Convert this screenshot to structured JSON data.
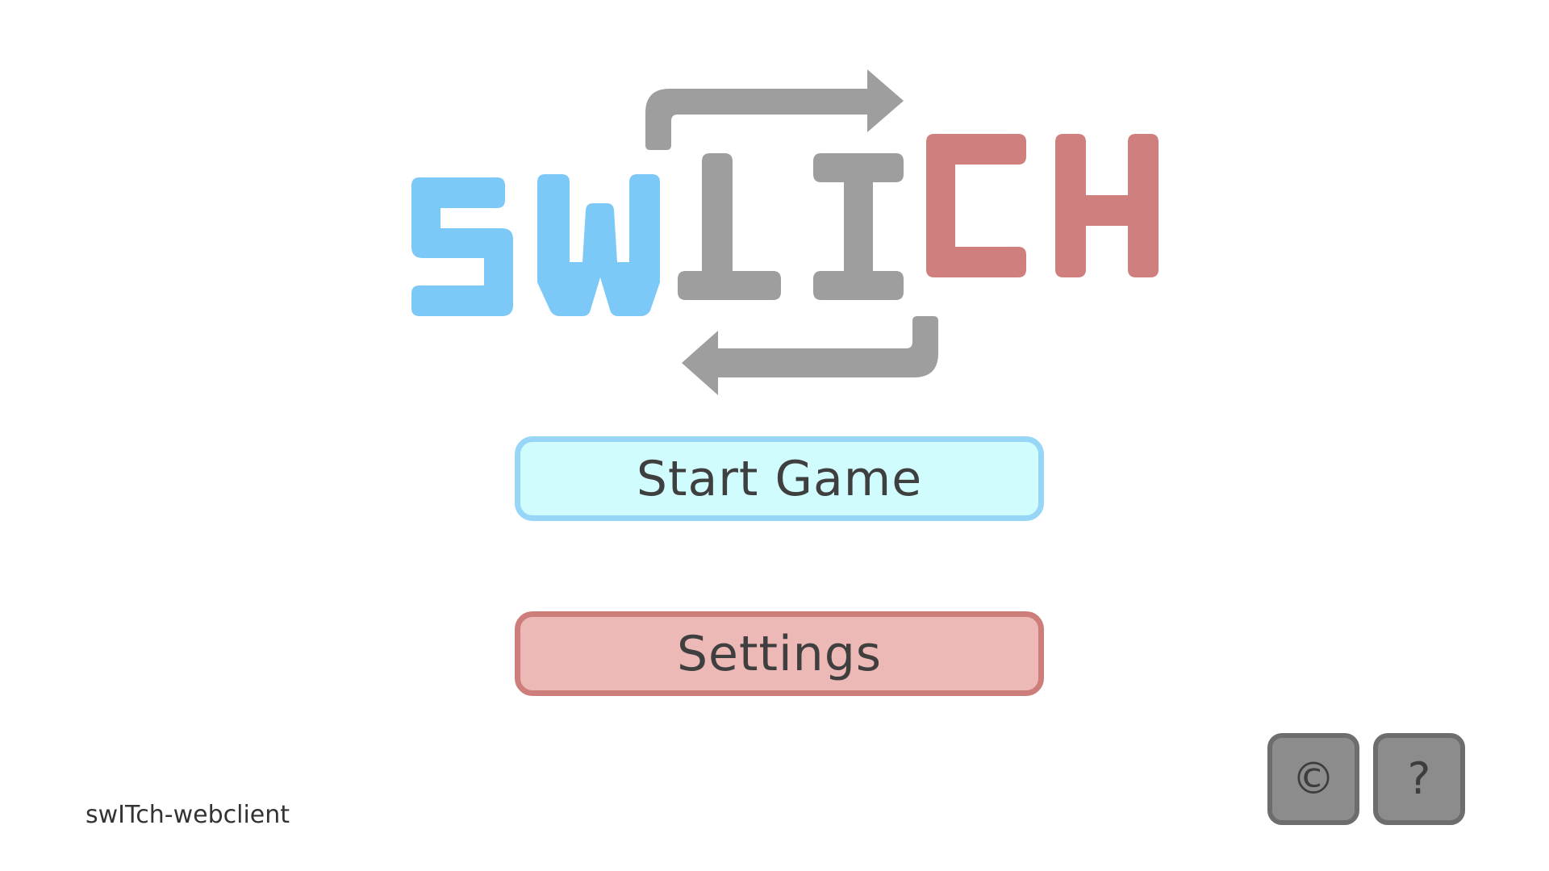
{
  "logo": {
    "letters": [
      "S",
      "W",
      "I",
      "I",
      "C",
      "H"
    ],
    "colors": {
      "blue": "#7cc8f6",
      "gray": "#9e9e9e",
      "red": "#cf7f7e"
    }
  },
  "menu": {
    "start_label": "Start Game",
    "settings_label": "Settings"
  },
  "corner_buttons": {
    "credits_icon": "copyright-icon",
    "credits_glyph": "©",
    "help_icon": "question-icon",
    "help_glyph": "?"
  },
  "footer": {
    "app_name": "swITch-webclient"
  },
  "colors": {
    "start_fill": "#d0fcfe",
    "start_border": "#98d6f8",
    "settings_fill": "#edb9b6",
    "settings_border": "#cd7e7b",
    "square_fill": "#8c8c8c",
    "square_border": "#6d6d6d"
  }
}
